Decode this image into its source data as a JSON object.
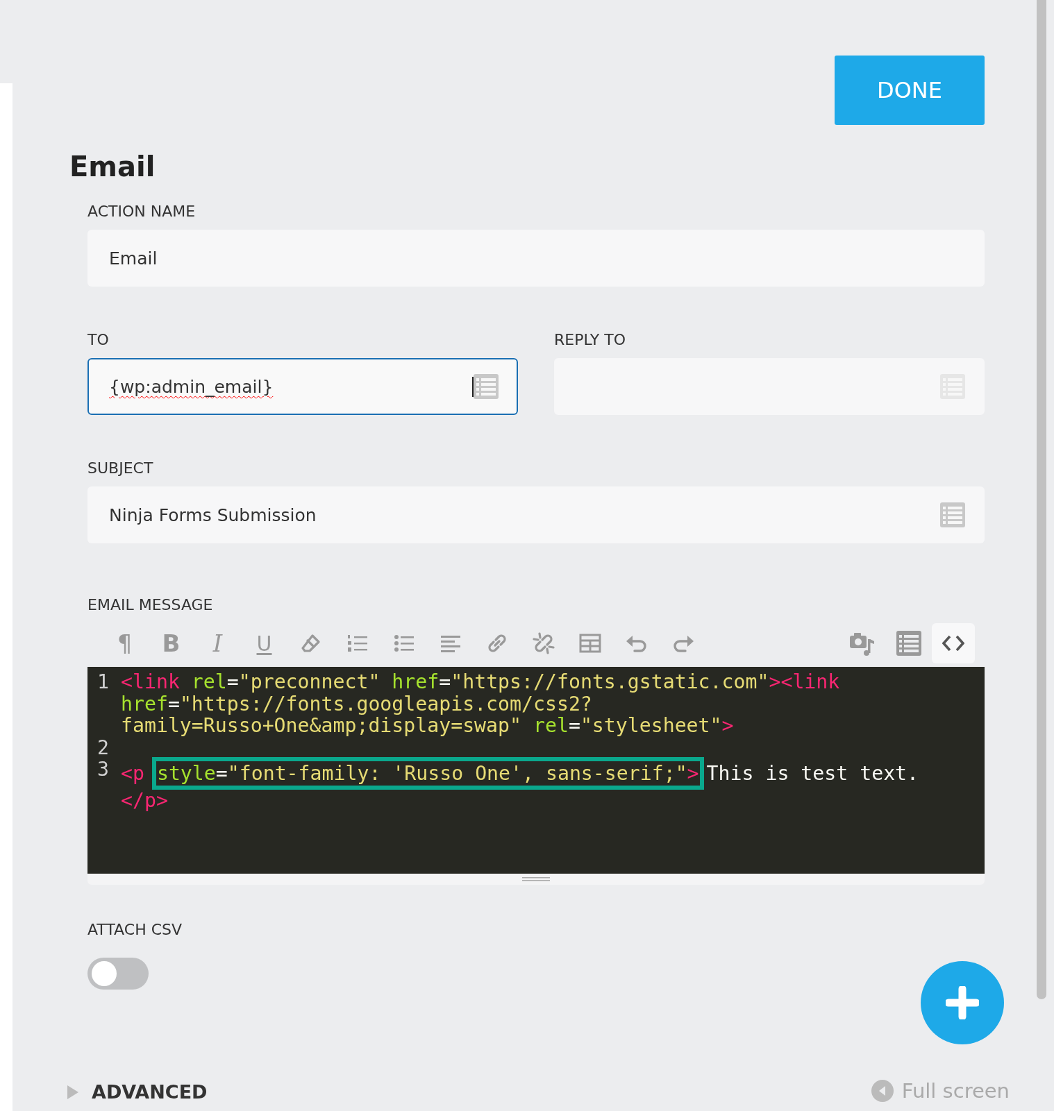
{
  "done_button": "DONE",
  "title": "Email",
  "field_rows": [
    [
      {
        "label": "ACTION NAME",
        "value": "Email",
        "focused": false,
        "merge_tags": false
      }
    ],
    [
      {
        "label": "TO",
        "value": "{wp:admin_email}",
        "focused": true,
        "merge_tags": true
      },
      {
        "label": "REPLY TO",
        "focused": false,
        "merge_tags": true
      }
    ],
    [
      {
        "label": "SUBJECT",
        "value": "Ninja Forms Submission",
        "focused": false,
        "merge_tags": true
      }
    ]
  ],
  "email_message": {
    "label": "EMAIL MESSAGE",
    "toolbar": [
      {
        "kind": "char",
        "text": "¶",
        "selected": false
      },
      {
        "kind": "bold",
        "text": "B",
        "selected": false
      },
      {
        "kind": "italic",
        "text": "I",
        "selected": false
      },
      {
        "kind": "underline",
        "text": "U",
        "selected": false
      },
      {
        "kind": "eraser",
        "selected": false
      },
      {
        "kind": "ordered-list",
        "selected": false
      },
      {
        "kind": "bullet-list",
        "selected": false
      },
      {
        "kind": "align-left",
        "selected": false
      },
      {
        "kind": "link",
        "selected": false
      },
      {
        "kind": "unlink",
        "selected": false
      },
      {
        "kind": "table",
        "selected": false
      },
      {
        "kind": "undo",
        "selected": false
      },
      {
        "kind": "redo",
        "selected": false
      },
      {
        "kind": "spacer"
      },
      {
        "kind": "media",
        "selected": false
      },
      {
        "kind": "merge-tags",
        "selected": false
      },
      {
        "kind": "code",
        "selected": true
      }
    ],
    "code_lines": [
      {
        "number": "1",
        "rows": [
          {
            "tokens": [
              {
                "kind": "tag",
                "text": "<link"
              },
              {
                "kind": "attr",
                "text": " rel"
              },
              {
                "kind": "plain",
                "text": "="
              },
              {
                "kind": "string",
                "text": "\"preconnect\""
              },
              {
                "kind": "attr",
                "text": " href"
              },
              {
                "kind": "plain",
                "text": "="
              },
              {
                "kind": "string",
                "text": "\"https://fonts.gstatic.com\""
              },
              {
                "kind": "tag",
                "text": "><link"
              }
            ]
          },
          {
            "tokens": [
              {
                "kind": "attr",
                "text": "href"
              },
              {
                "kind": "plain",
                "text": "="
              },
              {
                "kind": "string",
                "text": "\"https://fonts.googleapis.com/css2?"
              }
            ]
          },
          {
            "tokens": [
              {
                "kind": "string",
                "text": "family=Russo+One&amp;display=swap\""
              },
              {
                "kind": "attr",
                "text": " rel"
              },
              {
                "kind": "plain",
                "text": "="
              },
              {
                "kind": "string",
                "text": "\"stylesheet\""
              },
              {
                "kind": "tag",
                "text": ">"
              }
            ]
          }
        ]
      },
      {
        "number": "2"
      },
      {
        "number": "3",
        "rows": [
          {
            "tokens": [
              {
                "kind": "tag",
                "text": "<p "
              },
              {
                "kind": "highlight",
                "tokens": [
                  {
                    "kind": "attr",
                    "text": "style"
                  },
                  {
                    "kind": "plain",
                    "text": "="
                  },
                  {
                    "kind": "string",
                    "text": "\"font-family: 'Russo One', sans-serif;\""
                  },
                  {
                    "kind": "tag",
                    "text": ">"
                  }
                ]
              },
              {
                "kind": "plain",
                "text": "This is test text."
              }
            ]
          },
          {
            "tokens": [
              {
                "kind": "tag",
                "text": "</p>"
              }
            ]
          }
        ]
      }
    ]
  },
  "attach_csv": {
    "label": "ATTACH CSV",
    "on": false
  },
  "advanced": {
    "label": "ADVANCED",
    "expanded": false
  },
  "full_screen": "Full screen"
}
